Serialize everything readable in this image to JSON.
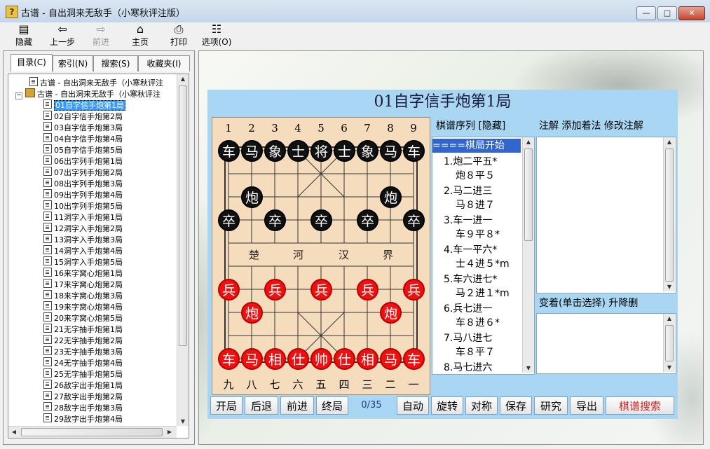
{
  "window": {
    "icon": "?",
    "title": "古谱 - 自出洞来无敌手（小寒秋评注版）",
    "min": "—",
    "max": "□",
    "close": "✕"
  },
  "toolbar": {
    "hide": {
      "label": "隐藏",
      "icon": "hide-panel-icon",
      "glyph": "▤"
    },
    "back": {
      "label": "上一步",
      "icon": "arrow-left-icon",
      "glyph": "⇦"
    },
    "forward": {
      "label": "前进",
      "icon": "arrow-right-icon",
      "glyph": "⇨"
    },
    "home": {
      "label": "主页",
      "icon": "home-icon",
      "glyph": "⌂"
    },
    "print": {
      "label": "打印",
      "icon": "printer-icon",
      "glyph": "⎙"
    },
    "options": {
      "label": "选项(O)",
      "icon": "options-icon",
      "glyph": "☷"
    }
  },
  "tabs": [
    "目录(C)",
    "索引(N)",
    "搜索(S)",
    "收藏夹(I)"
  ],
  "tree": {
    "root1": "古谱 - 自出洞来无敌手（小寒秋评注",
    "root2": "古谱 - 自出洞来无敌手（小寒秋评注",
    "items": [
      "01自字信手炮第1局",
      "02自字信手炮第2局",
      "03自字信手炮第3局",
      "04自字信手炮第4局",
      "05自字信手炮第5局",
      "06出字列手炮第1局",
      "07出字列手炮第2局",
      "08出字列手炮第3局",
      "09出字列手炮第4局",
      "10出字列手炮第5局",
      "11洞字入手炮第1局",
      "12洞字入手炮第2局",
      "13洞字入手炮第3局",
      "14洞字入手炮第4局",
      "15洞字入手炮第5局",
      "16来字窝心炮第1局",
      "17来字窝心炮第2局",
      "18来字窝心炮第3局",
      "19来字窝心炮第4局",
      "20来字窝心炮第5局",
      "21无字抽手炮第1局",
      "22无字抽手炮第2局",
      "23无字抽手炮第3局",
      "24无字抽手炮第4局",
      "25无字抽手炮第5局",
      "26敌字出手炮第1局",
      "27敌字出手炮第2局",
      "28敌字出手炮第3局",
      "29敌字出手炮第4局"
    ]
  },
  "game": {
    "title": "01自字信手炮第1局",
    "files_top": [
      "1",
      "2",
      "3",
      "4",
      "5",
      "6",
      "7",
      "8",
      "9"
    ],
    "files_bottom": [
      "九",
      "八",
      "七",
      "六",
      "五",
      "四",
      "三",
      "二",
      "一"
    ],
    "river": [
      "楚",
      "河",
      "汉",
      "界"
    ],
    "pieces": [
      {
        "side": "black",
        "char": "车",
        "file": 0,
        "rank": 0
      },
      {
        "side": "black",
        "char": "马",
        "file": 1,
        "rank": 0
      },
      {
        "side": "black",
        "char": "象",
        "file": 2,
        "rank": 0
      },
      {
        "side": "black",
        "char": "士",
        "file": 3,
        "rank": 0
      },
      {
        "side": "black",
        "char": "将",
        "file": 4,
        "rank": 0
      },
      {
        "side": "black",
        "char": "士",
        "file": 5,
        "rank": 0
      },
      {
        "side": "black",
        "char": "象",
        "file": 6,
        "rank": 0
      },
      {
        "side": "black",
        "char": "马",
        "file": 7,
        "rank": 0
      },
      {
        "side": "black",
        "char": "车",
        "file": 8,
        "rank": 0
      },
      {
        "side": "black",
        "char": "炮",
        "file": 1,
        "rank": 2
      },
      {
        "side": "black",
        "char": "炮",
        "file": 7,
        "rank": 2
      },
      {
        "side": "black",
        "char": "卒",
        "file": 0,
        "rank": 3
      },
      {
        "side": "black",
        "char": "卒",
        "file": 2,
        "rank": 3
      },
      {
        "side": "black",
        "char": "卒",
        "file": 4,
        "rank": 3
      },
      {
        "side": "black",
        "char": "卒",
        "file": 6,
        "rank": 3
      },
      {
        "side": "black",
        "char": "卒",
        "file": 8,
        "rank": 3
      },
      {
        "side": "red",
        "char": "兵",
        "file": 0,
        "rank": 6
      },
      {
        "side": "red",
        "char": "兵",
        "file": 2,
        "rank": 6
      },
      {
        "side": "red",
        "char": "兵",
        "file": 4,
        "rank": 6
      },
      {
        "side": "red",
        "char": "兵",
        "file": 6,
        "rank": 6
      },
      {
        "side": "red",
        "char": "兵",
        "file": 8,
        "rank": 6
      },
      {
        "side": "red",
        "char": "炮",
        "file": 1,
        "rank": 7
      },
      {
        "side": "red",
        "char": "炮",
        "file": 7,
        "rank": 7
      },
      {
        "side": "red",
        "char": "车",
        "file": 0,
        "rank": 9
      },
      {
        "side": "red",
        "char": "马",
        "file": 1,
        "rank": 9
      },
      {
        "side": "red",
        "char": "相",
        "file": 2,
        "rank": 9
      },
      {
        "side": "red",
        "char": "仕",
        "file": 3,
        "rank": 9
      },
      {
        "side": "red",
        "char": "帅",
        "file": 4,
        "rank": 9
      },
      {
        "side": "red",
        "char": "仕",
        "file": 5,
        "rank": 9
      },
      {
        "side": "red",
        "char": "相",
        "file": 6,
        "rank": 9
      },
      {
        "side": "red",
        "char": "马",
        "file": 7,
        "rank": 9
      },
      {
        "side": "red",
        "char": "车",
        "file": 8,
        "rank": 9
      }
    ]
  },
  "moves": {
    "header": "棋谱序列  [隐藏]",
    "start": "====棋局开始",
    "list": [
      {
        "red": "1.炮二平五*",
        "black": "炮８平５"
      },
      {
        "red": "2.马二进三",
        "black": "马８进７"
      },
      {
        "red": "3.车一进一",
        "black": "车９平８*"
      },
      {
        "red": "4.车一平六*",
        "black": "士４进５*m"
      },
      {
        "red": "5.车六进七*",
        "black": "马２进１*m"
      },
      {
        "red": "6.兵七进一",
        "black": "车８进６*"
      },
      {
        "red": "7.马八进七",
        "black": "车８平７"
      },
      {
        "red": "8.马七进六",
        "black": ""
      }
    ]
  },
  "notes": {
    "header": "注解  添加着法  修改注解",
    "variations_header": "变着(单击选择)  升降删"
  },
  "buttons": {
    "start": "开局",
    "back": "后退",
    "forward": "前进",
    "end": "终局",
    "counter": "0/35",
    "auto": "自动",
    "rotate": "旋转",
    "mirror": "对称",
    "save": "保存",
    "study": "研究",
    "export": "导出",
    "search": "棋谱搜索"
  }
}
